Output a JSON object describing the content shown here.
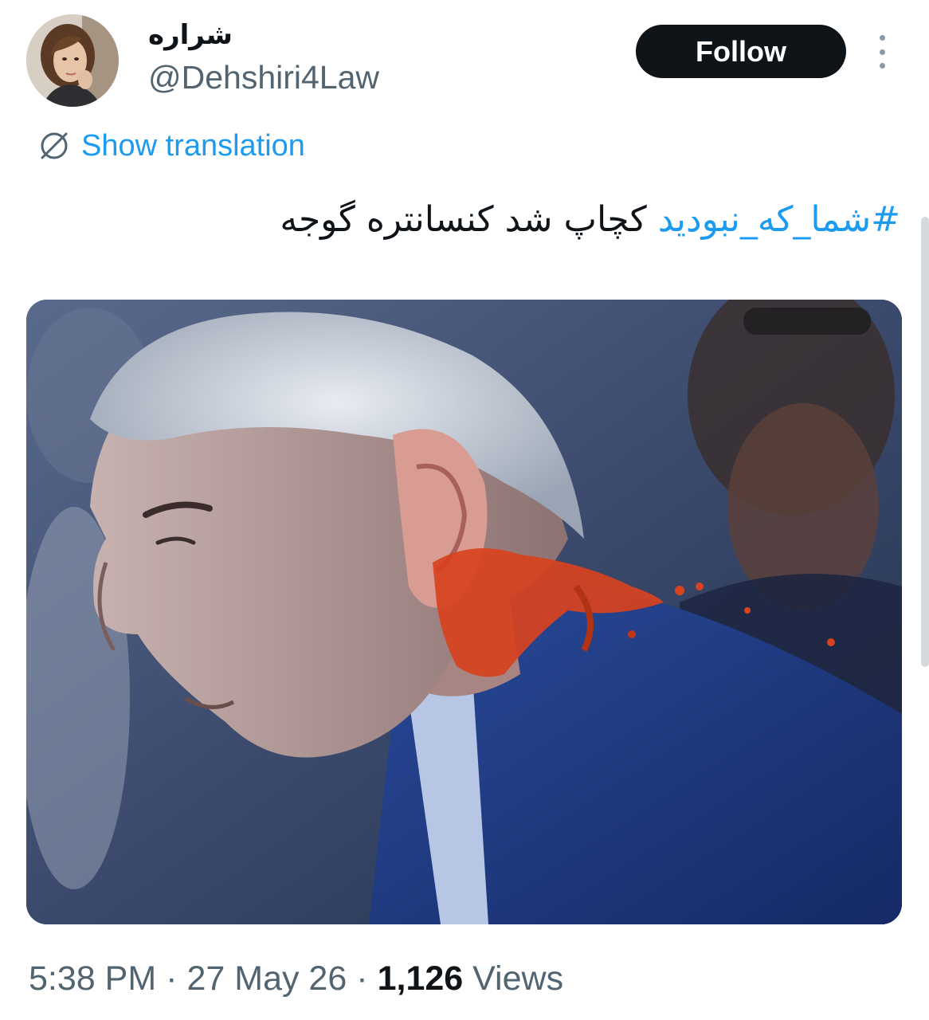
{
  "author": {
    "display_name": "شراره",
    "handle": "@Dehshiri4Law",
    "avatar_icon": "profile-avatar"
  },
  "follow": {
    "label": "Follow"
  },
  "more_icon": "more-vertical-icon",
  "translation": {
    "icon": "globe-icon",
    "label": "Show translation"
  },
  "tweet": {
    "hashtag": "#شما_که_نبودید",
    "text": " کچاپ شد کنسانتره گوجه"
  },
  "meta": {
    "time": "5:38 PM",
    "separator": "·",
    "date": "27 May 26",
    "views_count": "1,126",
    "views_label": "Views"
  },
  "colors": {
    "link": "#1d9bf0",
    "text": "#0f1419",
    "secondary": "#536471",
    "button_bg": "#0f1419"
  }
}
